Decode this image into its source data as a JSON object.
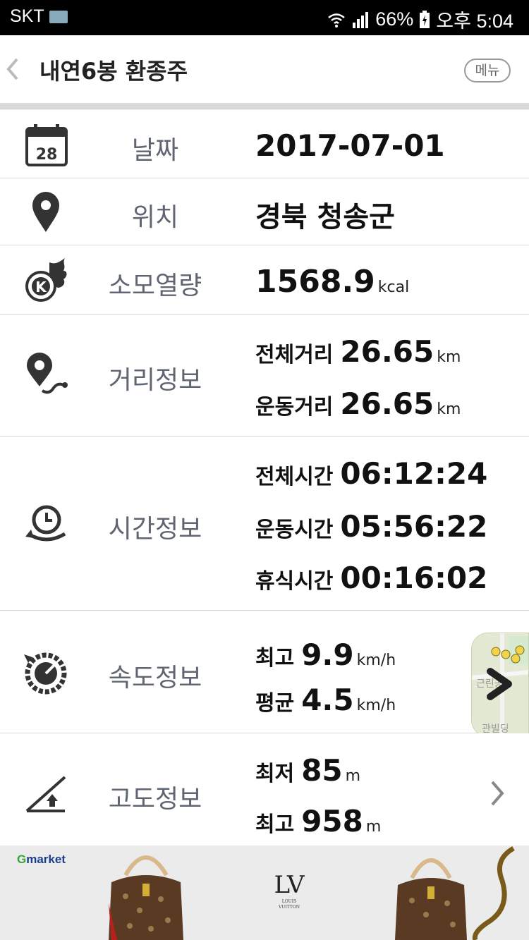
{
  "status_bar": {
    "carrier": "SKT",
    "battery": "66%",
    "time": "오후 5:04"
  },
  "header": {
    "title": "내연6봉 환종주",
    "menu_label": "메뉴"
  },
  "rows": {
    "date": {
      "label": "날짜",
      "value": "2017-07-01",
      "icon_text": "28"
    },
    "location": {
      "label": "위치",
      "value": "경북 청송군"
    },
    "calories": {
      "label": "소모열량",
      "value": "1568.9",
      "unit": "kcal"
    },
    "distance": {
      "label": "거리정보",
      "total_label": "전체거리",
      "total_value": "26.65",
      "total_unit": "km",
      "moving_label": "운동거리",
      "moving_value": "26.65",
      "moving_unit": "km"
    },
    "time": {
      "label": "시간정보",
      "total_label": "전체시간",
      "total_value": "06:12:24",
      "moving_label": "운동시간",
      "moving_value": "05:56:22",
      "rest_label": "휴식시간",
      "rest_value": "00:16:02"
    },
    "speed": {
      "label": "속도정보",
      "max_label": "최고",
      "max_value": "9.9",
      "max_unit": "km/h",
      "avg_label": "평균",
      "avg_value": "4.5",
      "avg_unit": "km/h"
    },
    "altitude": {
      "label": "고도정보",
      "min_label": "최저",
      "min_value": "85",
      "min_unit": "m",
      "max_label": "최고",
      "max_value": "958",
      "max_unit": "m"
    }
  },
  "map_thumbnail": {
    "text_1": "근린공",
    "text_2": "관빌딩"
  },
  "ad": {
    "brand_g": "G",
    "brand_rest": "market",
    "logo_text": "LV"
  },
  "colors": {
    "label_gray": "#5f6672",
    "divider": "#d6d6d6",
    "status_bar": "#000000"
  }
}
